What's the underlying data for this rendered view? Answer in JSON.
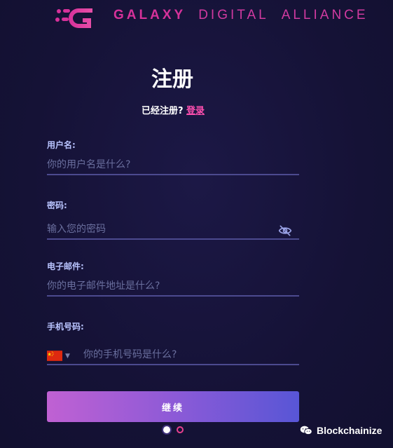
{
  "brand": {
    "name_strong": "GALAXY",
    "name_rest_1": "DIGITAL",
    "name_rest_2": "ALLIANCE",
    "logo_icon": "galaxy-g-logo"
  },
  "page": {
    "title": "注册",
    "already_registered": "已经注册?",
    "login_link": "登录"
  },
  "form": {
    "username": {
      "label": "用户名:",
      "placeholder": "你的用户名是什么?"
    },
    "password": {
      "label": "密码:",
      "placeholder": "输入您的密码",
      "toggle_icon": "eye-off-icon"
    },
    "email": {
      "label": "电子邮件:",
      "placeholder": "你的电子邮件地址是什么?"
    },
    "phone": {
      "label": "手机号码:",
      "placeholder": "你的手机号码是什么?",
      "country_flag": "china-flag-icon"
    },
    "submit_label": "继续"
  },
  "pagination": {
    "current": 1,
    "total": 2
  },
  "watermark": {
    "text": "Blockchainize",
    "icon": "wechat-icon"
  },
  "colors": {
    "accent_pink": "#d6319a",
    "link_pink": "#ff4fb0",
    "label_blue": "#b9c4ff",
    "button_gradient_start": "#c061d3",
    "button_gradient_end": "#5856d6",
    "background": "#16133a"
  }
}
